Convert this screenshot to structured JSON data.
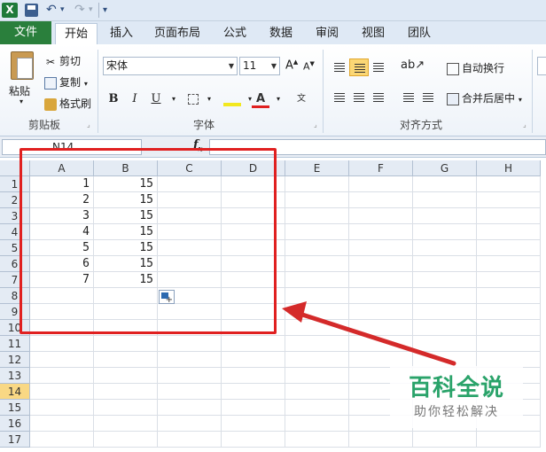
{
  "quick_access": {
    "logo": "X",
    "undo_icon": "undo-icon",
    "redo_icon": "redo-icon",
    "customize_icon": "customize-icon"
  },
  "tabs": [
    {
      "label": "文件"
    },
    {
      "label": "开始"
    },
    {
      "label": "插入"
    },
    {
      "label": "页面布局"
    },
    {
      "label": "公式"
    },
    {
      "label": "数据"
    },
    {
      "label": "审阅"
    },
    {
      "label": "视图"
    },
    {
      "label": "团队"
    }
  ],
  "ribbon": {
    "clipboard": {
      "paste": "粘贴",
      "cut": "剪切",
      "copy": "复制",
      "format_painter": "格式刷",
      "group_label": "剪贴板"
    },
    "font": {
      "font_name": "宋体",
      "font_size": "11",
      "bold": "B",
      "italic": "I",
      "underline": "U",
      "group_label": "字体"
    },
    "alignment": {
      "wrap_text": "自动换行",
      "merge_center": "合并后居中",
      "group_label": "对齐方式"
    }
  },
  "formula_bar": {
    "name_box": "N14",
    "fx": "f",
    "formula": ""
  },
  "sheet": {
    "columns": [
      "A",
      "B",
      "C",
      "D",
      "E",
      "F",
      "G",
      "H"
    ],
    "rows": [
      "1",
      "2",
      "3",
      "4",
      "5",
      "6",
      "7",
      "8",
      "9",
      "10",
      "11",
      "12",
      "13",
      "14",
      "15",
      "16",
      "17"
    ],
    "active_row": "14",
    "data": [
      [
        "1",
        "15"
      ],
      [
        "2",
        "15"
      ],
      [
        "3",
        "15"
      ],
      [
        "4",
        "15"
      ],
      [
        "5",
        "15"
      ],
      [
        "6",
        "15"
      ],
      [
        "7",
        "15"
      ]
    ]
  },
  "annotation": {
    "box_color": "#e02020",
    "arrow_color": "#d42a2a"
  },
  "watermark": {
    "title": "百科全说",
    "subtitle": "助你轻松解决"
  },
  "colors": {
    "file_tab": "#2a7f3c",
    "highlight": "#f9d884",
    "accent": "#fbd775"
  }
}
